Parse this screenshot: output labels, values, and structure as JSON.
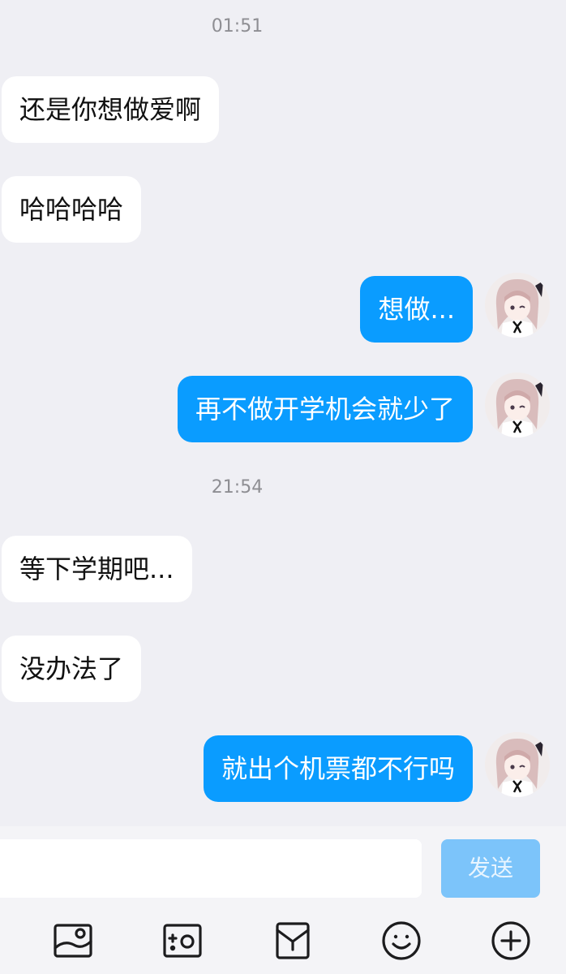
{
  "chat": {
    "timestamps": [
      "01:51",
      "21:54"
    ],
    "messages": [
      {
        "side": "in",
        "text": "还是你想做爱啊"
      },
      {
        "side": "in",
        "text": "哈哈哈哈"
      },
      {
        "side": "out",
        "text": "想做..."
      },
      {
        "side": "out",
        "text": "再不做开学机会就少了"
      },
      {
        "side": "in",
        "text": "等下学期吧..."
      },
      {
        "side": "in",
        "text": "没办法了"
      },
      {
        "side": "out",
        "text": "就出个机票都不行吗"
      }
    ]
  },
  "composer": {
    "input_value": "",
    "send_label": "发送"
  },
  "toolbar": {
    "icons": [
      "image-icon",
      "camera-icon",
      "red-packet-icon",
      "emoji-icon",
      "plus-icon"
    ]
  },
  "colors": {
    "background": "#efeff4",
    "incoming_bubble": "#ffffff",
    "outgoing_bubble": "#0a9cff",
    "send_button": "#7cc4fa"
  }
}
